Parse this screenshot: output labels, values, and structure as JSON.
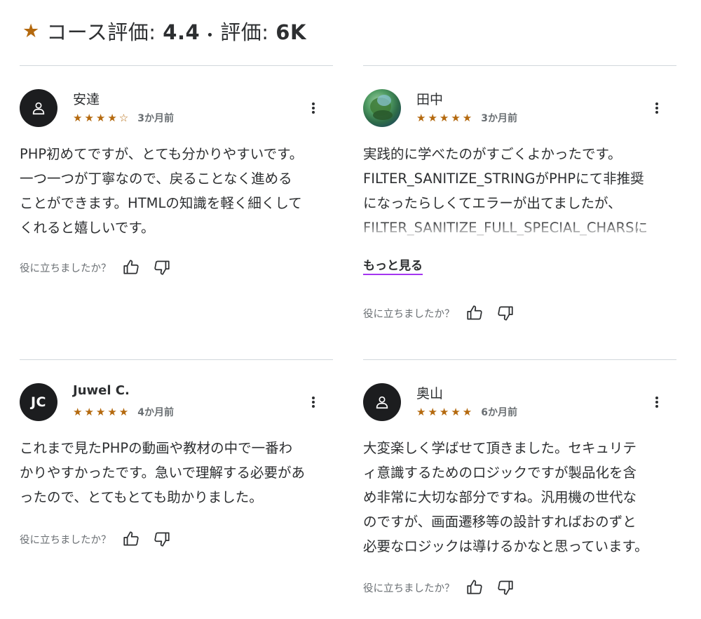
{
  "header": {
    "course_rating_label": "コース評価:",
    "course_rating_value": "4.4",
    "separator": "•",
    "ratings_label": "評価:",
    "ratings_value": "6K"
  },
  "helpful_prompt": "役に立ちましたか？",
  "show_more_label": "もっと見る",
  "colors": {
    "star": "#b4690e",
    "text": "#2d2f31",
    "muted": "#6a6f73",
    "divider": "#d1d7dc",
    "accent_underline": "#a435f0",
    "avatar_bg": "#1c1d1f"
  },
  "reviews": [
    {
      "name": "安達",
      "avatar": "person-icon",
      "stars": "★★★★☆",
      "rating": 4,
      "time": "3か月前",
      "text": [
        "PHP初めてですが、とても分かりやすいです。",
        "一つ一つが丁寧なので、戻ることなく進める",
        "ことができます。HTMLの知識を軽く細くして",
        "くれると嬉しいです。"
      ]
    },
    {
      "name": "田中",
      "avatar": "photo-avatar",
      "stars": "★★★★★",
      "rating": 5,
      "time": "3か月前",
      "text": [
        "実践的に学べたのがすごくよかったです。",
        "FILTER_SANITIZE_STRINGがPHPにて非推奨",
        "になったらしくてエラーが出てましたが、",
        "FILTER_SANITIZE_FULL_SPECIAL_CHARSに"
      ]
    },
    {
      "name": "Juwel C.",
      "avatar_initials": "JC",
      "stars": "★★★★★",
      "rating": 5,
      "time": "4か月前",
      "text": [
        "これまで見たPHPの動画や教材の中で一番わ",
        "かりやすかったです。急いで理解する必要があ",
        "ったので、とてもとても助かりました。"
      ]
    },
    {
      "name": "奥山",
      "avatar": "person-icon",
      "stars": "★★★★★",
      "rating": 5,
      "time": "6か月前",
      "text": [
        "大変楽しく学ばせて頂きました。セキュリテ",
        "ィ意識するためのロジックですが製品化を含",
        "め非常に大切な部分ですね。汎用機の世代な",
        "のですが、画面遷移等の設計すればおのずと",
        "必要なロジックは導けるかなと思っています。"
      ]
    }
  ]
}
